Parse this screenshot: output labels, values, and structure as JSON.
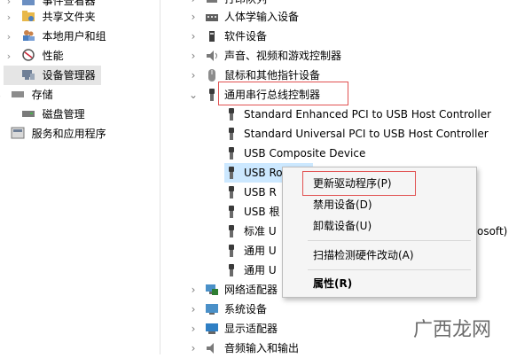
{
  "left_tree": [
    {
      "label": "事件查看器",
      "chevron": "›",
      "icon": "event-viewer-icon"
    },
    {
      "label": "共享文件夹",
      "chevron": "›",
      "icon": "shared-folder-icon"
    },
    {
      "label": "本地用户和组",
      "chevron": "›",
      "icon": "users-icon"
    },
    {
      "label": "性能",
      "chevron": "›",
      "icon": "performance-icon"
    },
    {
      "label": "设备管理器",
      "chevron": "",
      "icon": "device-manager-icon"
    },
    {
      "label": "存储",
      "chevron": "⌄",
      "icon": "storage-icon"
    },
    {
      "label": "磁盘管理",
      "chevron": "",
      "icon": "disk-icon"
    },
    {
      "label": "服务和应用程序",
      "chevron": "›",
      "icon": "services-icon"
    }
  ],
  "device_tree": [
    {
      "label": "打印队列",
      "chevron": "›",
      "icon": "printer-icon",
      "level": 0
    },
    {
      "label": "人体学输入设备",
      "chevron": "›",
      "icon": "hid-icon",
      "level": 0
    },
    {
      "label": "软件设备",
      "chevron": "›",
      "icon": "software-device-icon",
      "level": 0
    },
    {
      "label": "声音、视频和游戏控制器",
      "chevron": "›",
      "icon": "speaker-icon",
      "level": 0
    },
    {
      "label": "鼠标和其他指针设备",
      "chevron": "›",
      "icon": "mouse-icon",
      "level": 0
    },
    {
      "label": "通用串行总线控制器",
      "chevron": "⌄",
      "icon": "usb-icon",
      "level": 0
    },
    {
      "label": "Standard Enhanced PCI to USB Host Controller",
      "icon": "usb-icon",
      "level": 1
    },
    {
      "label": "Standard Universal PCI to USB Host Controller",
      "icon": "usb-icon",
      "level": 1
    },
    {
      "label": "USB Composite Device",
      "icon": "usb-icon",
      "level": 1
    },
    {
      "label": "USB Root Hub",
      "icon": "usb-icon",
      "level": 1
    },
    {
      "label": "USB R",
      "icon": "usb-icon",
      "level": 1
    },
    {
      "label": "USB 根",
      "icon": "usb-icon",
      "level": 1
    },
    {
      "label": "标准 U",
      "icon": "usb-icon",
      "level": 1,
      "tail": "osoft)"
    },
    {
      "label": "通用 U",
      "icon": "usb-icon",
      "level": 1
    },
    {
      "label": "通用 U",
      "icon": "usb-icon",
      "level": 1
    },
    {
      "label": "网络适配器",
      "chevron": "›",
      "icon": "network-icon",
      "level": 0
    },
    {
      "label": "系统设备",
      "chevron": "›",
      "icon": "system-icon",
      "level": 0
    },
    {
      "label": "显示适配器",
      "chevron": "›",
      "icon": "display-icon",
      "level": 0
    },
    {
      "label": "音频输入和输出",
      "chevron": "›",
      "icon": "audio-icon",
      "level": 0
    }
  ],
  "context_menu": {
    "update_driver": "更新驱动程序(P)",
    "disable_device": "禁用设备(D)",
    "uninstall_device": "卸载设备(U)",
    "scan_hardware": "扫描检测硬件改动(A)",
    "properties": "属性(R)"
  },
  "watermark": "广西龙网",
  "colors": {
    "highlight": "#e15151",
    "selection": "#cce8ff"
  }
}
